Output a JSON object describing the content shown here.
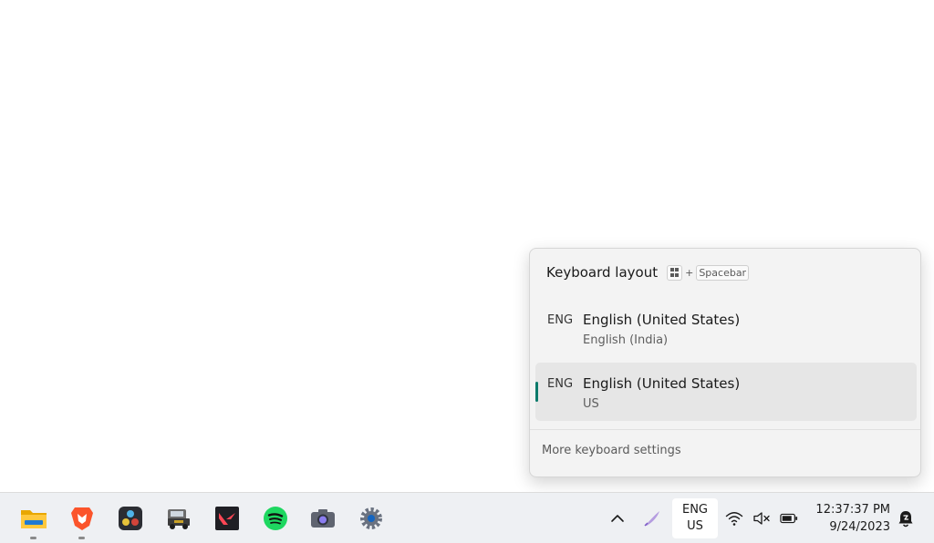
{
  "flyout": {
    "title": "Keyboard layout",
    "shortcut": {
      "plus": "+",
      "key": "Spacebar"
    },
    "items": [
      {
        "code": "ENG",
        "name": "English (United States)",
        "sub": "English (India)",
        "selected": false
      },
      {
        "code": "ENG",
        "name": "English (United States)",
        "sub": "US",
        "selected": true
      }
    ],
    "more_settings": "More keyboard settings",
    "accent_color": "#0b7a6b"
  },
  "taskbar": {
    "apps": [
      {
        "name": "file-explorer-icon",
        "running": true
      },
      {
        "name": "brave-browser-icon",
        "running": true
      },
      {
        "name": "davinci-resolve-icon",
        "running": false
      },
      {
        "name": "truck-simulator-icon",
        "running": false
      },
      {
        "name": "valorant-icon",
        "running": false
      },
      {
        "name": "spotify-icon",
        "running": false
      },
      {
        "name": "camera-icon",
        "running": false
      },
      {
        "name": "settings-icon",
        "running": false
      }
    ],
    "ime": {
      "line1": "ENG",
      "line2": "US"
    },
    "clock": {
      "time": "12:37:37 PM",
      "date": "9/24/2023"
    },
    "tray_icons": [
      "chevron-up-icon",
      "pen-icon",
      "wifi-icon",
      "volume-muted-icon",
      "battery-icon",
      "notification-icon"
    ]
  }
}
